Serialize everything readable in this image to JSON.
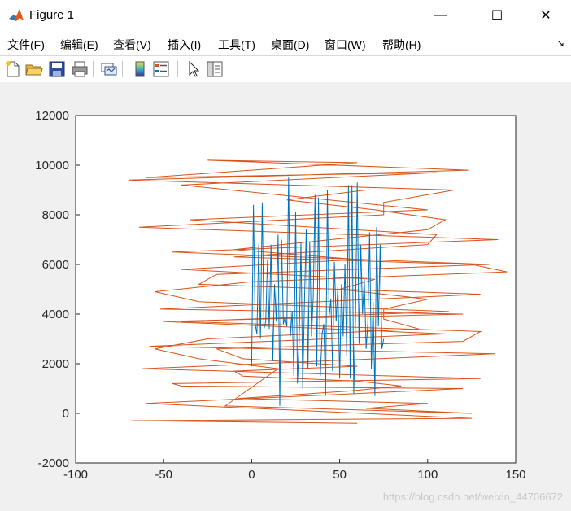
{
  "window": {
    "title": "Figure 1",
    "minimize_glyph": "—",
    "maximize_glyph": "☐",
    "close_glyph": "✕",
    "icon": "matlab-icon"
  },
  "menu": {
    "items": [
      {
        "label": "文件",
        "key": "(F)"
      },
      {
        "label": "编辑",
        "key": "(E)"
      },
      {
        "label": "查看",
        "key": "(V)"
      },
      {
        "label": "插入",
        "key": "(I)"
      },
      {
        "label": "工具",
        "key": "(T)"
      },
      {
        "label": "桌面",
        "key": "(D)"
      },
      {
        "label": "窗口",
        "key": "(W)"
      },
      {
        "label": "帮助",
        "key": "(H)"
      }
    ],
    "overflow_glyph": "↘"
  },
  "toolbar": {
    "icons": [
      "new-figure-icon",
      "open-file-icon",
      "save-icon",
      "print-icon",
      "link-plot-icon",
      "colorbar-icon",
      "legend-icon",
      "pointer-icon",
      "property-editor-icon"
    ]
  },
  "watermark": "https://blog.csdn.net/weixin_44706672",
  "chart_data": {
    "type": "line",
    "title": "",
    "xlabel": "",
    "ylabel": "",
    "xlim": [
      -100,
      150
    ],
    "ylim": [
      -2000,
      12000
    ],
    "xticks": [
      "-100",
      "-50",
      "0",
      "50",
      "100",
      "150"
    ],
    "yticks": [
      "-2000",
      "0",
      "2000",
      "4000",
      "6000",
      "8000",
      "10000",
      "12000"
    ],
    "grid": false,
    "legend": "none",
    "colors": {
      "blue": "#0072bd",
      "orange": "#d95319"
    },
    "series": [
      {
        "color": "#0072bd",
        "x": [
          0,
          1,
          2,
          3,
          4,
          5,
          6,
          7,
          8,
          9,
          10,
          11,
          12,
          13,
          14,
          15,
          16,
          17,
          18,
          19,
          20,
          21,
          22,
          23,
          24,
          25,
          26,
          27,
          28,
          29,
          30,
          31,
          32,
          33,
          34,
          35,
          36,
          37,
          38,
          39,
          40,
          41,
          42,
          43,
          44,
          45,
          46,
          47,
          48,
          49,
          50,
          51,
          52,
          53,
          54,
          55,
          56,
          57,
          58,
          59,
          60,
          61,
          62,
          63,
          64,
          65,
          66,
          67,
          68,
          69,
          70,
          71,
          72,
          73,
          74,
          75
        ],
        "y": [
          1900,
          8400,
          3600,
          3200,
          6800,
          3000,
          8500,
          3400,
          3700,
          6200,
          3400,
          6800,
          2100,
          5200,
          3700,
          7200,
          300,
          7000,
          3600,
          3900,
          3500,
          9500,
          3100,
          4100,
          1500,
          8100,
          1200,
          2900,
          6900,
          1000,
          4500,
          7400,
          1800,
          6900,
          3100,
          4700,
          8800,
          1900,
          8700,
          1500,
          3200,
          3600,
          700,
          9000,
          3900,
          4600,
          1700,
          6100,
          3700,
          5100,
          1400,
          5200,
          3100,
          6000,
          2300,
          9200,
          1400,
          9200,
          800,
          3900,
          9300,
          2800,
          6800,
          4000,
          5400,
          2600,
          3600,
          7300,
          1800,
          4500,
          700,
          7500,
          3500,
          6800,
          2600,
          3000
        ]
      },
      {
        "color": "#d95319",
        "x": [
          60,
          -68,
          125,
          -60,
          120,
          -40,
          -45,
          130,
          -62,
          138,
          -58,
          110,
          -50,
          120,
          -52,
          130,
          -30,
          -20,
          135,
          -45,
          140,
          -64,
          75,
          75,
          115,
          -70,
          123,
          -25,
          60,
          -60,
          105,
          -40,
          100,
          -35,
          105,
          100,
          -10,
          125,
          145,
          0,
          -55,
          -30,
          112,
          -40,
          130,
          120,
          -20,
          -5,
          60,
          -10,
          -5,
          60,
          85,
          55,
          -8,
          100,
          65,
          125,
          -15,
          15,
          -30,
          -55,
          -25,
          95,
          75,
          75,
          100,
          50,
          70,
          -40,
          60,
          -10,
          45,
          100,
          110,
          70,
          20,
          65
        ],
        "y": [
          -400,
          -300,
          -200,
          400,
          1000,
          1100,
          1200,
          1400,
          1800,
          2400,
          2700,
          3200,
          3700,
          4000,
          4200,
          4800,
          5200,
          5600,
          6000,
          6500,
          7000,
          7500,
          8000,
          8500,
          9000,
          9400,
          9800,
          10200,
          10100,
          9500,
          9700,
          9200,
          8200,
          7800,
          7200,
          6800,
          6300,
          6000,
          5700,
          5300,
          4900,
          4500,
          4100,
          3700,
          3300,
          2900,
          2600,
          2200,
          1900,
          1700,
          1500,
          1300,
          1100,
          900,
          600,
          400,
          200,
          0,
          300,
          1800,
          2200,
          2600,
          3000,
          3400,
          3800,
          4200,
          4600,
          5000,
          5400,
          5800,
          6200,
          6600,
          7000,
          7400,
          7800,
          8200,
          8600,
          9000
        ]
      }
    ]
  }
}
